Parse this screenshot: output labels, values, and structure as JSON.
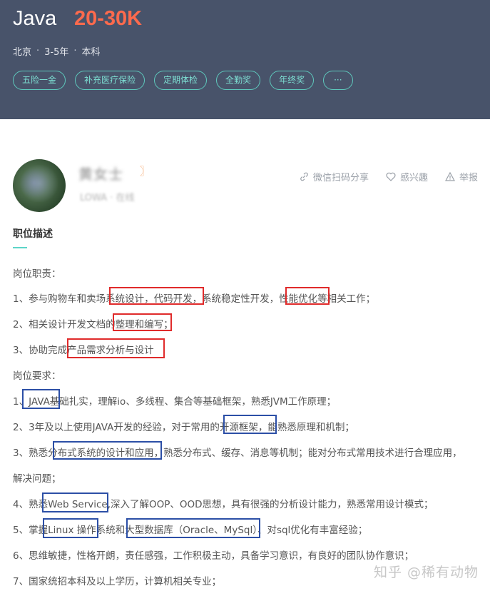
{
  "header": {
    "title": "Java",
    "salary": "20-30K",
    "location": "北京",
    "experience": "3-5年",
    "education": "本科",
    "separator": "·",
    "tags": [
      "五险一金",
      "补充医疗保险",
      "定期体检",
      "全勤奖",
      "年终奖",
      "···"
    ]
  },
  "recruiter": {
    "name": "黄女士",
    "name_suffix": "〗",
    "subtitle": "LOWA · 在线",
    "subtitle_tail": "线"
  },
  "actions": {
    "share": "微信扫码分享",
    "interest": "感兴趣",
    "report": "举报"
  },
  "section": {
    "title": "职位描述"
  },
  "description": {
    "lines": [
      "岗位职责：",
      "1、参与购物车和卖场系统设计，代码开发，系统稳定性开发，性能优化等相关工作；",
      "2、相关设计开发文档的整理和编写；",
      "3、协助完成产品需求分析与设计",
      "岗位要求：",
      "1、JAVA基础扎实，理解io、多线程、集合等基础框架，熟悉JVM工作原理；",
      "2、3年及以上使用JAVA开发的经验，对于常用的开源框架，能熟悉原理和机制；",
      "3、熟悉分布式系统的设计和应用，熟悉分布式、缓存、消息等机制；能对分布式常用技术进行合理应用，",
      "解决问题；",
      "4、熟悉Web Service,深入了解OOP、OOD思想，具有很强的分析设计能力，熟悉常用设计模式；",
      "5、掌握Linux 操作系统和大型数据库（Oracle、MySql）、对sql优化有丰富经验；",
      "6、思维敏捷，性格开朗，责任感强，工作积极主动，具备学习意识，有良好的团队协作意识；",
      "7、国家统招本科及以上学历，计算机相关专业；"
    ]
  },
  "watermark": "知乎 @稀有动物",
  "colors": {
    "header_bg": "#48536a",
    "salary": "#fd6a4d",
    "tag": "#5ec9bd",
    "accent": "#5dd5c8",
    "highlight_red": "#e02b2b",
    "highlight_blue": "#2c4fa6"
  }
}
